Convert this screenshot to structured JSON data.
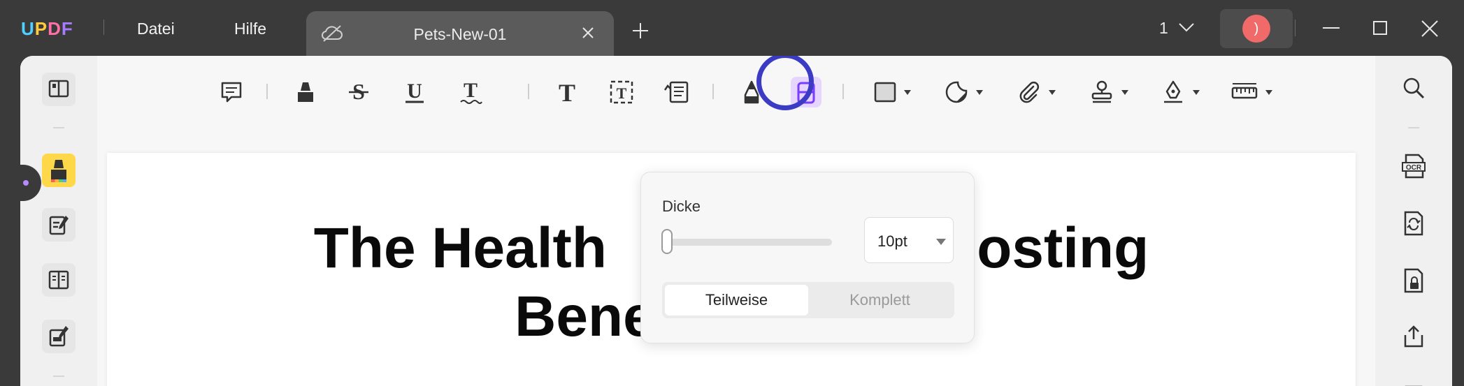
{
  "app": {
    "logo_letters": [
      {
        "char": "U",
        "color": "#4fd1ff"
      },
      {
        "char": "P",
        "color": "#ffcb3d"
      },
      {
        "char": "D",
        "color": "#ff6fa8"
      },
      {
        "char": "F",
        "color": "#a57bff"
      }
    ]
  },
  "menu": {
    "file": "Datei",
    "help": "Hilfe"
  },
  "tab": {
    "title": "Pets-New-01",
    "icon": "cloud-off-icon"
  },
  "header": {
    "page_number": "1",
    "avatar_initial": ")",
    "avatar_color": "#f06a6a"
  },
  "toolbar": {
    "tools": [
      "comment-icon",
      "highlight-icon",
      "strikethrough-icon",
      "underline-icon",
      "squiggly-icon",
      "text-icon",
      "textbox-icon",
      "text-callout-icon",
      "pencil-icon",
      "eraser-icon",
      "rectangle-icon",
      "sticker-icon",
      "attachment-icon",
      "stamp-icon",
      "signature-icon",
      "measure-icon"
    ],
    "active_tool": "eraser-icon",
    "accent_color": "#3b3bc4"
  },
  "left_rail": {
    "items": [
      "reader-icon",
      "comment-mode-icon",
      "edit-pdf-icon",
      "organize-pages-icon",
      "fill-sign-icon"
    ],
    "active": "comment-mode-icon"
  },
  "right_rail": {
    "items": [
      "search-icon",
      "ocr-icon",
      "convert-icon",
      "protect-icon",
      "share-icon"
    ],
    "ocr_label": "OCR"
  },
  "document": {
    "title_line1": "The Health",
    "title_line1_end": "Boosting",
    "title_line2": "Benefits of Pets"
  },
  "eraser_popover": {
    "thickness_label": "Dicke",
    "thickness_value": "10pt",
    "thickness_fraction": 0.0,
    "mode_partial": "Teilweise",
    "mode_full": "Komplett",
    "selected_mode": "Teilweise"
  }
}
